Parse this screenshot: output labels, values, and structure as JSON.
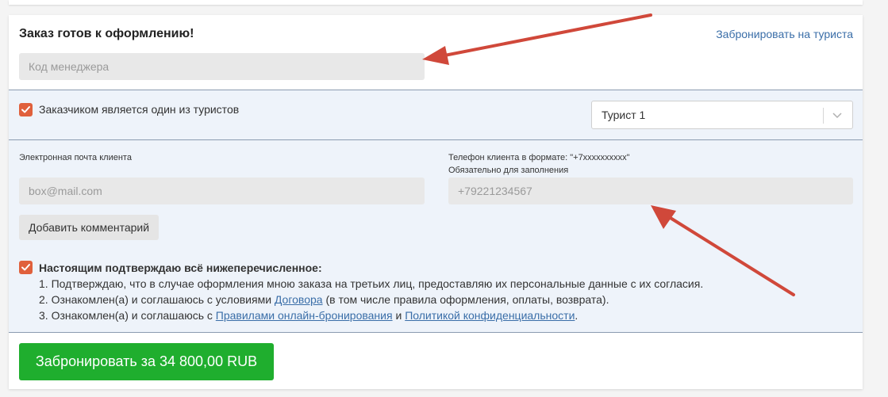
{
  "order": {
    "title": "Заказ готов к оформлению!",
    "book_for_tourist_link": "Забронировать на туриста",
    "manager_code_placeholder": "Код менеджера"
  },
  "customer": {
    "checkbox_label": "Заказчиком является один из туристов",
    "checkbox_checked": true,
    "tourist_select_value": "Турист 1",
    "tourist_select_icon": "chevron-down-icon"
  },
  "contacts": {
    "email_label": "Электронная почта клиента",
    "email_placeholder": "box@mail.com",
    "phone_label_line1": "Телефон клиента в формате: \"+7xxxxxxxxxx\"",
    "phone_label_line2": "Обязательно для заполнения",
    "phone_placeholder": "+79221234567",
    "add_comment_label": "Добавить комментарий"
  },
  "consent": {
    "checked": true,
    "heading": "Настоящим подтверждаю всё нижеперечисленное:",
    "line1": "1. Подтверждаю, что в случае оформления мною заказа на третьих лиц, предоставляю их персональные данные с их согласия.",
    "line2_before": "2. Ознакомлен(а) и соглашаюсь с условиями ",
    "line2_link": "Договора",
    "line2_after": " (в том числе правила оформления, оплаты, возврата).",
    "line3_before": "3. Ознакомлен(а) и соглашаюсь с ",
    "line3_link1": "Правилами онлайн-бронирования",
    "line3_mid": " и ",
    "line3_link2": "Политикой конфиденциальности",
    "line3_after": "."
  },
  "submit": {
    "label": "Забронировать за 34 800,00 RUB"
  },
  "colors": {
    "accent_checkbox": "#e0603c",
    "submit_green": "#1fae2e",
    "link_blue": "#3a6ea8",
    "arrow_red": "#d0483a"
  }
}
